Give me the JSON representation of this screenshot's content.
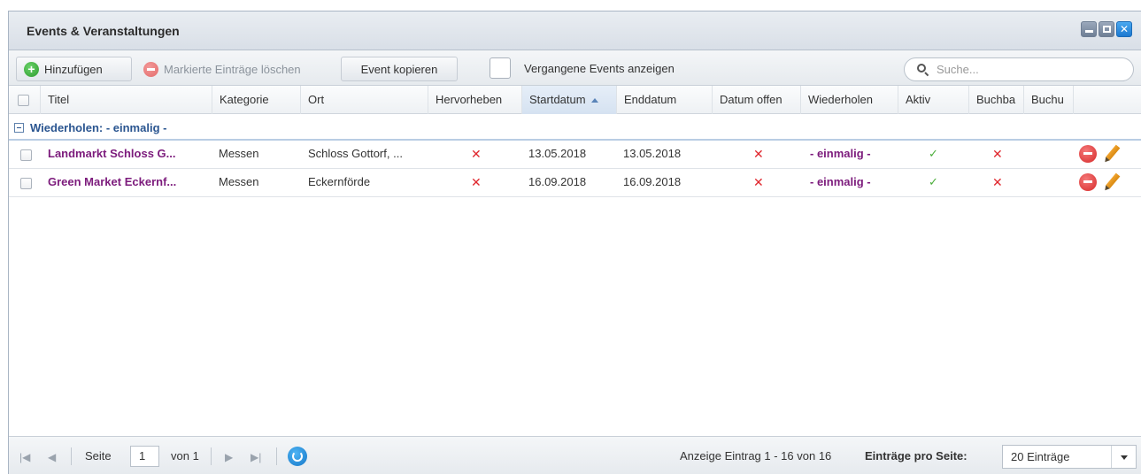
{
  "window": {
    "title": "Events & Veranstaltungen"
  },
  "toolbar": {
    "add_label": "Hinzufügen",
    "delete_label": "Markierte Einträge löschen",
    "copy_label": "Event kopieren",
    "past_label": "Vergangene Events anzeigen",
    "search_placeholder": "Suche..."
  },
  "columns": [
    {
      "key": "titel",
      "label": "Titel"
    },
    {
      "key": "kategorie",
      "label": "Kategorie"
    },
    {
      "key": "ort",
      "label": "Ort"
    },
    {
      "key": "hervorheben",
      "label": "Hervorheben"
    },
    {
      "key": "startdatum",
      "label": "Startdatum",
      "sorted": "asc"
    },
    {
      "key": "enddatum",
      "label": "Enddatum"
    },
    {
      "key": "datum_offen",
      "label": "Datum offen"
    },
    {
      "key": "wiederholen",
      "label": "Wiederholen"
    },
    {
      "key": "aktiv",
      "label": "Aktiv"
    },
    {
      "key": "buchbar",
      "label": "Buchba"
    },
    {
      "key": "buchung",
      "label": "Buchu"
    }
  ],
  "group": {
    "label": "Wiederholen: - einmalig -"
  },
  "rows": [
    {
      "titel": "Landmarkt Schloss G...",
      "kategorie": "Messen",
      "ort": "Schloss Gottorf, ...",
      "hervorheben": false,
      "startdatum": "13.05.2018",
      "enddatum": "13.05.2018",
      "datum_offen": false,
      "wiederholen": "- einmalig -",
      "aktiv": true,
      "buchbar": false
    },
    {
      "titel": "Green Market Eckernf...",
      "kategorie": "Messen",
      "ort": "Eckernförde",
      "hervorheben": false,
      "startdatum": "16.09.2018",
      "enddatum": "16.09.2018",
      "datum_offen": false,
      "wiederholen": "- einmalig -",
      "aktiv": true,
      "buchbar": false
    }
  ],
  "pager": {
    "page_label": "Seite",
    "page_value": "1",
    "of_label": "von 1",
    "summary": "Anzeige Eintrag 1 - 16 von 16",
    "per_page_label": "Einträge pro Seite:",
    "per_page_value": "20 Einträge"
  },
  "icons": {
    "add": "plus-circle-icon",
    "delete": "minus-circle-icon",
    "search": "search-icon",
    "false_mark": "x-icon",
    "true_mark": "check-icon",
    "row_delete": "delete-icon",
    "row_edit": "pencil-icon",
    "refresh": "refresh-icon"
  },
  "colors": {
    "title_text": "#7c1b7c",
    "group_text": "#2a5590",
    "false_mark": "#e0272e",
    "true_mark": "#4cae3b",
    "accent_blue": "#1c78d0"
  }
}
